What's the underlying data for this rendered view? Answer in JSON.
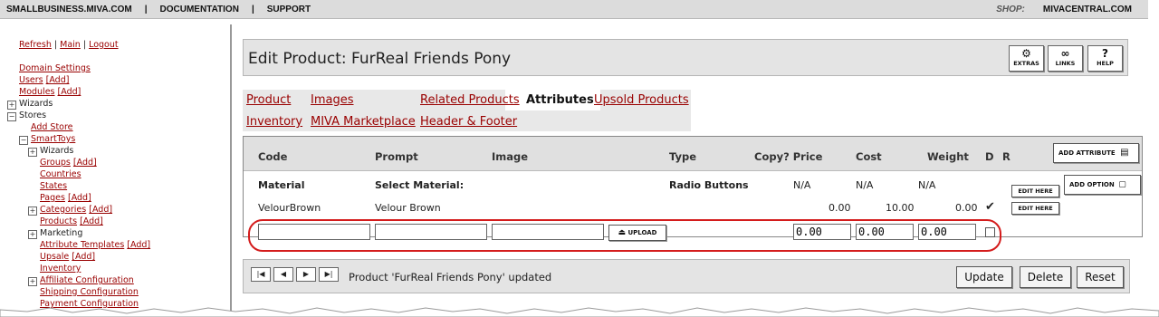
{
  "topbar": {
    "links": [
      "SMALLBUSINESS.MIVA.COM",
      "DOCUMENTATION",
      "SUPPORT"
    ],
    "shop_label": "SHOP:",
    "shop_value": "MIVACENTRAL.COM"
  },
  "leftnav": {
    "refresh": "Refresh",
    "main": "Main",
    "logout": "Logout",
    "domain_settings": "Domain Settings",
    "users": "Users",
    "modules": "Modules",
    "add": "[Add]",
    "wizards": "Wizards",
    "stores": "Stores",
    "add_store": "Add Store",
    "store_name": "SmartToys",
    "store_wizards": "Wizards",
    "groups": "Groups",
    "countries": "Countries",
    "states": "States",
    "pages": "Pages",
    "categories": "Categories",
    "products": "Products",
    "marketing": "Marketing",
    "attribute_templates": "Attribute Templates",
    "upsale": "Upsale",
    "inventory": "Inventory",
    "affiliate_configuration": "Affiliate Configuration",
    "shipping_configuration": "Shipping Configuration",
    "payment_configuration": "Payment Configuration",
    "plus": "+",
    "minus": "−"
  },
  "header": {
    "title": "Edit Product: FurReal Friends Pony",
    "buttons": [
      {
        "label": "EXTRAS",
        "icon": "extras-icon"
      },
      {
        "label": "LINKS",
        "icon": "links-icon"
      },
      {
        "label": "HELP",
        "icon": "help-icon"
      }
    ]
  },
  "tabs": {
    "product": "Product",
    "images": "Images",
    "related": "Related Products",
    "attributes": "Attributes",
    "upsold": "Upsold Products",
    "inventory": "Inventory",
    "marketplace": "MIVA Marketplace",
    "header_footer": "Header & Footer"
  },
  "attributes": {
    "columns": {
      "code": "Code",
      "prompt": "Prompt",
      "image": "Image",
      "type": "Type",
      "copy_price": "Copy? Price",
      "cost": "Cost",
      "weight": "Weight",
      "d": "D",
      "r": "R"
    },
    "add_attribute": "ADD ATTRIBUTE",
    "add_option": "ADD OPTION",
    "edit_here": "EDIT HERE",
    "attribute_row": {
      "code": "Material",
      "prompt": "Select Material:",
      "type": "Radio Buttons",
      "price": "N/A",
      "cost": "N/A",
      "weight": "N/A"
    },
    "option_row": {
      "code": "VelourBrown",
      "prompt": "Velour Brown",
      "price": "0.00",
      "cost": "10.00",
      "weight": "0.00",
      "default_mark": "✔"
    },
    "new_row": {
      "upload": "UPLOAD",
      "price": "0.00",
      "cost": "0.00",
      "weight": "0.00"
    }
  },
  "footer": {
    "status": "Product 'FurReal Friends Pony' updated",
    "update": "Update",
    "delete": "Delete",
    "reset": "Reset",
    "nav": [
      "|◀",
      "◀",
      "▶",
      "▶|"
    ]
  }
}
